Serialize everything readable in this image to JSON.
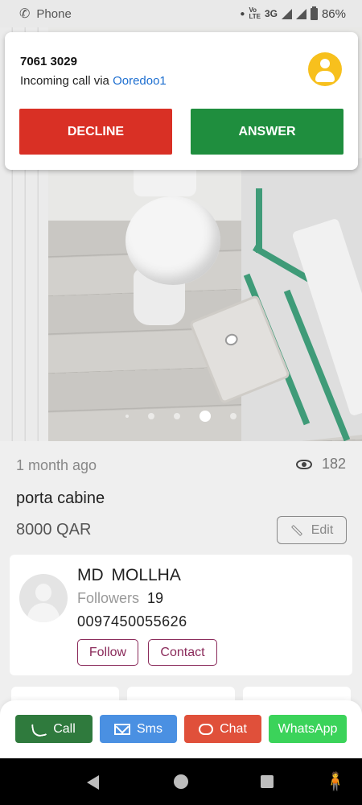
{
  "status_bar": {
    "app_name": "Phone",
    "volte": "Vo\nLTE",
    "network": "3G",
    "battery": "86%"
  },
  "call": {
    "number": "7061 3029",
    "via_prefix": "Incoming call via ",
    "carrier": "Ooredoo1",
    "decline_label": "DECLINE",
    "answer_label": "ANSWER",
    "decline_color": "#d93025",
    "answer_color": "#1f8e3e"
  },
  "gallery": {
    "dot_count": 4,
    "active_index": 2
  },
  "listing": {
    "posted": "1 month ago",
    "views": "182",
    "title": "porta cabine",
    "price": "8000 QAR",
    "edit_label": "Edit"
  },
  "seller": {
    "name": "MD  MOLLHA",
    "followers_label": "Followers",
    "followers_count": "19",
    "phone": "0097450055626",
    "follow_label": "Follow",
    "contact_label": "Contact",
    "accent_color": "#8a2a5a"
  },
  "actions": {
    "call_label": "Call",
    "sms_label": "Sms",
    "chat_label": "Chat",
    "whatsapp_label": "WhatsApp"
  }
}
